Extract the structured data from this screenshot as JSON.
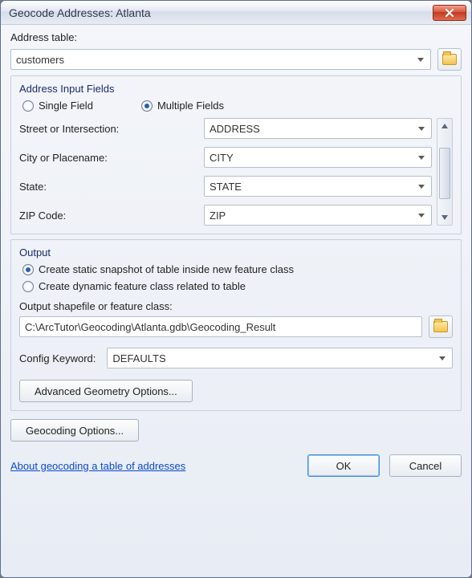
{
  "window": {
    "title": "Geocode Addresses:  Atlanta"
  },
  "address_table": {
    "label": "Address table:",
    "value": "customers"
  },
  "input_fields": {
    "legend": "Address Input Fields",
    "radio_single": "Single Field",
    "radio_multiple": "Multiple Fields",
    "rows": {
      "street_label": "Street or Intersection:",
      "street_value": "ADDRESS",
      "city_label": "City or Placename:",
      "city_value": "CITY",
      "state_label": "State:",
      "state_value": "STATE",
      "zip_label": "ZIP Code:",
      "zip_value": "ZIP"
    }
  },
  "output": {
    "legend": "Output",
    "radio_static": "Create static snapshot of table inside new feature class",
    "radio_dynamic": "Create dynamic feature class related to table",
    "path_label": "Output shapefile or feature class:",
    "path_value": "C:\\ArcTutor\\Geocoding\\Atlanta.gdb\\Geocoding_Result",
    "config_label": "Config Keyword:",
    "config_value": "DEFAULTS",
    "adv_geom_btn": "Advanced Geometry Options...",
    "geocoding_opts_btn": "Geocoding Options..."
  },
  "footer": {
    "link": "About geocoding a table of addresses",
    "ok": "OK",
    "cancel": "Cancel"
  }
}
